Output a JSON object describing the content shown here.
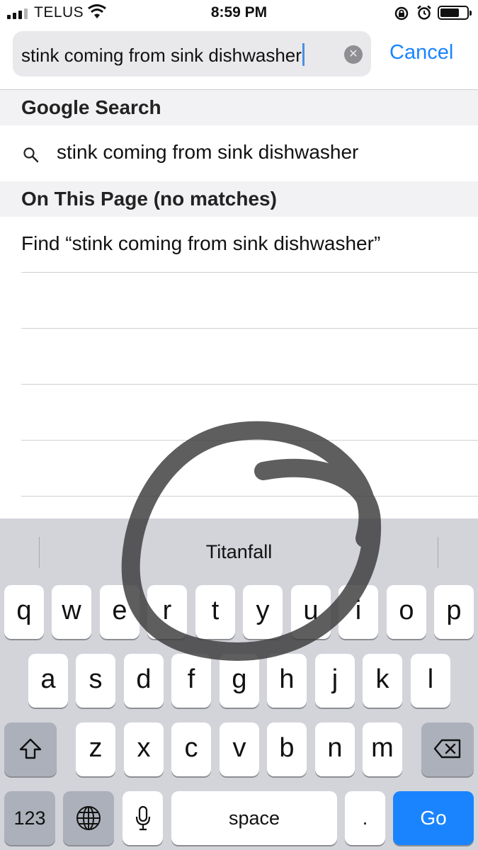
{
  "status_bar": {
    "carrier": "TELUS",
    "time": "8:59 PM"
  },
  "search": {
    "query": "stink coming from sink dishwasher",
    "cancel_label": "Cancel"
  },
  "google_section": {
    "header": "Google Search",
    "suggestion": "stink coming from sink dishwasher"
  },
  "page_section": {
    "header": "On This Page (no matches)",
    "find_text": "Find “stink coming from sink dishwasher”"
  },
  "keyboard": {
    "prediction": "Titanfall",
    "row1": [
      "q",
      "w",
      "e",
      "r",
      "t",
      "y",
      "u",
      "i",
      "o",
      "p"
    ],
    "row2": [
      "a",
      "s",
      "d",
      "f",
      "g",
      "h",
      "j",
      "k",
      "l"
    ],
    "row3": [
      "z",
      "x",
      "c",
      "v",
      "b",
      "n",
      "m"
    ],
    "numbers_label": "123",
    "space_label": "space",
    "period_label": ".",
    "go_label": "Go"
  },
  "colors": {
    "accent": "#1a84ff",
    "keyboard_bg": "#d2d4da"
  }
}
